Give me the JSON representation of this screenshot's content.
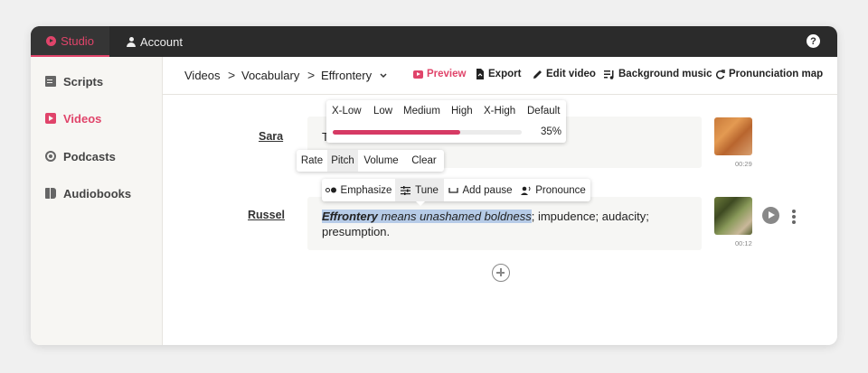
{
  "topbar": {
    "studio_label": "Studio",
    "account_label": "Account",
    "help_icon": "question-circle-icon"
  },
  "sidebar": {
    "items": [
      {
        "label": "Scripts",
        "icon": "document-icon"
      },
      {
        "label": "Videos",
        "icon": "video-icon",
        "active": true
      },
      {
        "label": "Podcasts",
        "icon": "podcast-icon"
      },
      {
        "label": "Audiobooks",
        "icon": "book-icon"
      }
    ]
  },
  "header": {
    "breadcrumb": [
      "Videos",
      "Vocabulary",
      "Effrontery"
    ],
    "separator": ">",
    "dropdown_icon": "chevron-down-icon",
    "tools": {
      "preview": "Preview",
      "export": "Export",
      "edit_video": "Edit video",
      "background_music": "Background music",
      "pronunciation_map": "Pronunciation map"
    }
  },
  "lines": [
    {
      "speaker": "Sara",
      "text": "T",
      "duration": "00:29"
    },
    {
      "speaker": "Russel",
      "text_highlight_bold": "Effrontery",
      "text_highlight_italic": " means unashamed boldness",
      "text_rest_1": "; impudence; audacity;",
      "text_rest_2": "presumption.",
      "duration": "00:12"
    }
  ],
  "pitch_popover": {
    "options": [
      "X-Low",
      "Low",
      "Medium",
      "High",
      "X-High",
      "Default"
    ],
    "value_percent": 35,
    "value_label": "35%"
  },
  "tune_tabs": {
    "options": [
      "Rate",
      "Pitch",
      "Volume",
      "Clear"
    ],
    "active": "Pitch"
  },
  "selection_toolbar": {
    "emphasize": "Emphasize",
    "tune": "Tune",
    "add_pause": "Add pause",
    "pronounce": "Pronounce"
  },
  "colors": {
    "accent": "#e0446a",
    "topbar": "#2b2b2b",
    "highlight": "#b6cbe7"
  }
}
